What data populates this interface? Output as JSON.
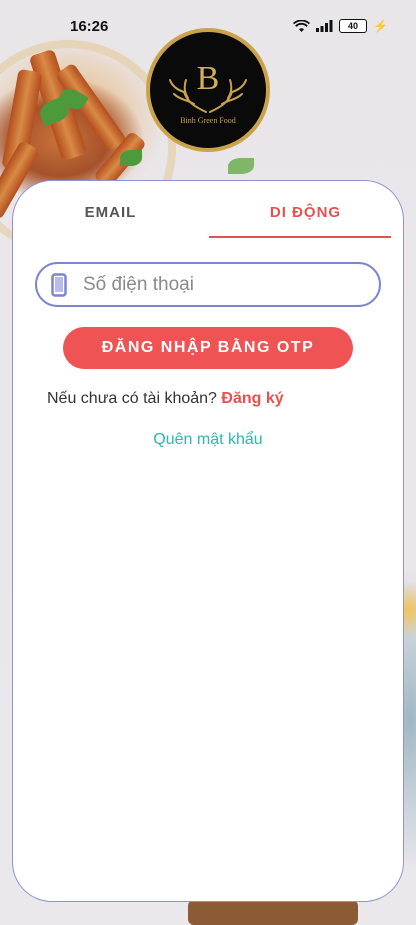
{
  "status_bar": {
    "time": "16:26",
    "battery": "40"
  },
  "logo": {
    "letter": "B",
    "brand": "Binh Green Food"
  },
  "tabs": [
    {
      "label": "EMAIL",
      "active": false
    },
    {
      "label": "DI ĐỘNG",
      "active": true
    }
  ],
  "phone": {
    "placeholder": "Số điện thoại",
    "value": ""
  },
  "otp_button": {
    "label": "ĐĂNG NHẬP BẰNG OTP"
  },
  "signup": {
    "prompt": "Nếu chưa có tài khoản?",
    "link": "Đăng ký"
  },
  "forgot": {
    "label": "Quên mật khẩu"
  },
  "colors": {
    "accent": "#e4524f",
    "button": "#ef5353",
    "input_border": "#7d84d4",
    "link_teal": "#2bbab0",
    "logo_gold": "#c9a24a"
  },
  "icons": {
    "wifi": "wifi-icon",
    "signal": "signal-icon",
    "battery": "battery-icon",
    "charging": "charging-icon",
    "phone": "phone-icon",
    "antlers": "antlers-icon"
  }
}
